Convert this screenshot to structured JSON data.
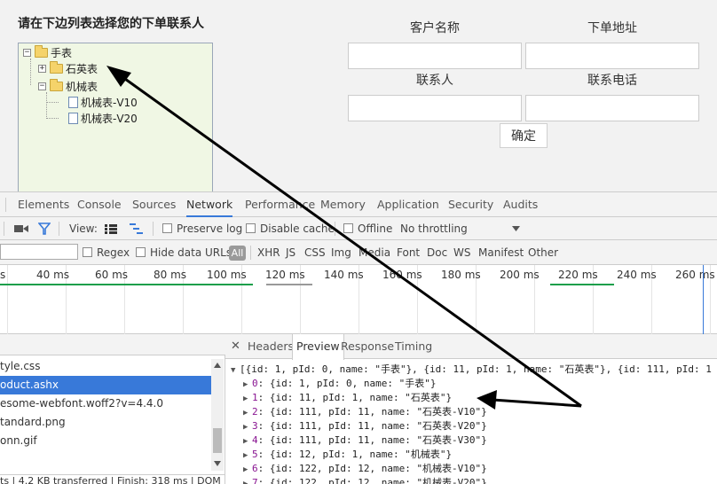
{
  "page": {
    "title": "请在下边列表选择您的下单联系人",
    "tree": [
      {
        "label": "手表",
        "type": "folder",
        "toggle": "−"
      },
      {
        "label": "石英表",
        "type": "folder",
        "toggle": "+"
      },
      {
        "label": "机械表",
        "type": "folder",
        "toggle": "−"
      },
      {
        "label": "机械表-V10",
        "type": "file"
      },
      {
        "label": "机械表-V20",
        "type": "file"
      }
    ],
    "fields": {
      "customer_name": "客户名称",
      "order_address": "下单地址",
      "contact": "联系人",
      "contact_phone": "联系电话"
    },
    "confirm_label": "确定"
  },
  "devtools": {
    "tabs": [
      "Elements",
      "Console",
      "Sources",
      "Network",
      "Performance",
      "Memory",
      "Application",
      "Security",
      "Audits"
    ],
    "active_tab": "Network",
    "toolbar": {
      "view_label": "View:",
      "preserve_log": "Preserve log",
      "disable_cache": "Disable cache",
      "offline": "Offline",
      "throttling": "No throttling"
    },
    "filter": {
      "regex": "Regex",
      "hide_data_urls": "Hide data URLs",
      "all": "All",
      "types": [
        "XHR",
        "JS",
        "CSS",
        "Img",
        "Media",
        "Font",
        "Doc",
        "WS",
        "Manifest",
        "Other"
      ]
    },
    "timeline_ticks": [
      "s",
      "40 ms",
      "60 ms",
      "80 ms",
      "100 ms",
      "120 ms",
      "140 ms",
      "160 ms",
      "180 ms",
      "200 ms",
      "220 ms",
      "240 ms",
      "260 ms"
    ],
    "requests": [
      "tyle.css",
      "oduct.ashx",
      "esome-webfont.woff2?v=4.4.0",
      "tandard.png",
      "onn.gif"
    ],
    "selected_request": 1,
    "status_bar": "ts | 4.2 KB transferred | Finish: 318 ms | DOM",
    "detail_tabs": [
      "Headers",
      "Preview",
      "Response",
      "Timing"
    ],
    "active_detail_tab": "Preview",
    "preview": {
      "summary": "[{id: 1, pId: 0, name: \"手表\"}, {id: 11, pId: 1, name: \"石英表\"}, {id: 111, pId: 1",
      "items": [
        {
          "index": "0",
          "body": "{id: 1, pId: 0, name: \"手表\"}"
        },
        {
          "index": "1",
          "body": "{id: 11, pId: 1, name: \"石英表\"}"
        },
        {
          "index": "2",
          "body": "{id: 111, pId: 11, name: \"石英表-V10\"}"
        },
        {
          "index": "3",
          "body": "{id: 111, pId: 11, name: \"石英表-V20\"}"
        },
        {
          "index": "4",
          "body": "{id: 111, pId: 11, name: \"石英表-V30\"}"
        },
        {
          "index": "5",
          "body": "{id: 12, pId: 1, name: \"机械表\"}"
        },
        {
          "index": "6",
          "body": "{id: 122, pId: 12, name: \"机械表-V10\"}"
        },
        {
          "index": "7",
          "body": "{id: 122, pId: 12, name: \"机械表-V20\"}"
        }
      ]
    }
  },
  "colors": {
    "tree_bg": "#f0f7e4",
    "accent_blue": "#3879d9",
    "arrow": "#000000"
  }
}
